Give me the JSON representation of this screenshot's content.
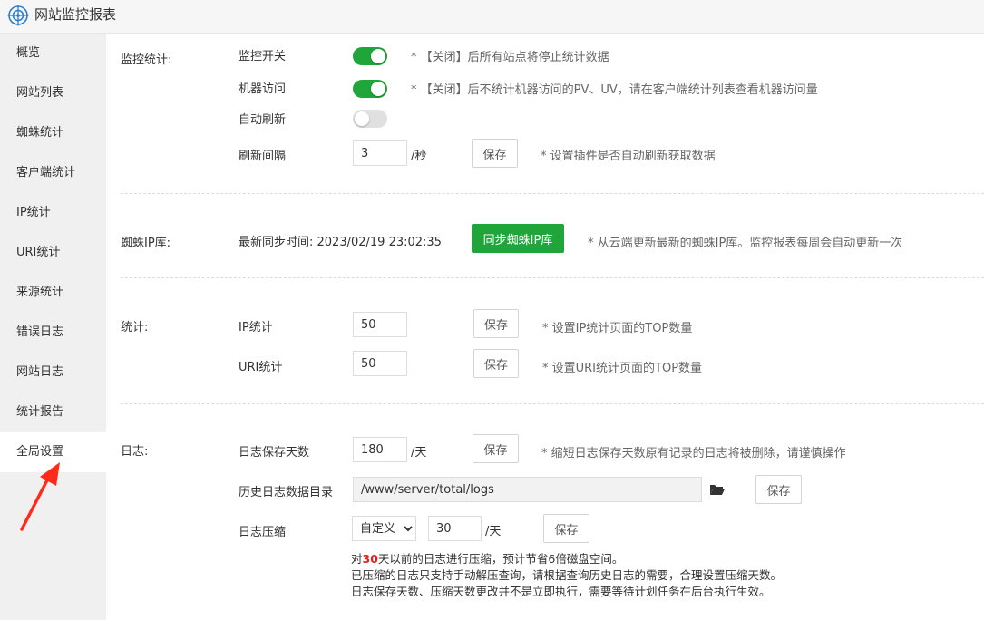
{
  "header": {
    "title": "网站监控报表",
    "icon": "globe-target-icon"
  },
  "sidebar": {
    "items": [
      {
        "label": "概览"
      },
      {
        "label": "网站列表"
      },
      {
        "label": "蜘蛛统计"
      },
      {
        "label": "客户端统计"
      },
      {
        "label": "IP统计"
      },
      {
        "label": "URI统计"
      },
      {
        "label": "来源统计"
      },
      {
        "label": "错误日志"
      },
      {
        "label": "网站日志"
      },
      {
        "label": "统计报告"
      },
      {
        "label": "全局设置",
        "active": true
      }
    ]
  },
  "monitor": {
    "section_label": "监控统计:",
    "switch_label": "监控开关",
    "switch_on": true,
    "switch_hint": "* 【关闭】后所有站点将停止统计数据",
    "bot_label": "机器访问",
    "bot_on": true,
    "bot_hint": "* 【关闭】后不统计机器访问的PV、UV，请在客户端统计列表查看机器访问量",
    "auto_refresh_label": "自动刷新",
    "auto_refresh_on": false,
    "interval_label": "刷新间隔",
    "interval_value": "3",
    "interval_unit": "/秒",
    "save_label": "保存",
    "interval_hint": "* 设置插件是否自动刷新获取数据"
  },
  "spider": {
    "section_label": "蜘蛛IP库:",
    "sync_time_text": "最新同步时间: 2023/02/19 23:02:35",
    "sync_button": "同步蜘蛛IP库",
    "hint": "* 从云端更新最新的蜘蛛IP库。监控报表每周会自动更新一次"
  },
  "stats": {
    "section_label": "统计:",
    "ip_label": "IP统计",
    "ip_value": "50",
    "ip_save": "保存",
    "ip_hint": "* 设置IP统计页面的TOP数量",
    "uri_label": "URI统计",
    "uri_value": "50",
    "uri_save": "保存",
    "uri_hint": "* 设置URI统计页面的TOP数量"
  },
  "logs": {
    "section_label": "日志:",
    "keep_days_label": "日志保存天数",
    "keep_days_value": "180",
    "keep_days_unit": "/天",
    "keep_days_save": "保存",
    "keep_days_hint": "* 缩短日志保存天数原有记录的日志将被删除，请谨慎操作",
    "dir_label": "历史日志数据目录",
    "dir_value": "/www/server/total/logs",
    "dir_save": "保存",
    "compress_label": "日志压缩",
    "compress_mode": "自定义",
    "compress_days": "30",
    "compress_unit": "/天",
    "compress_save": "保存",
    "note_prefix": "对",
    "note_days": "30",
    "note_suffix": "天以前的日志进行压缩，预计节省6倍磁盘空间。",
    "note_line2": "已压缩的日志只支持手动解压查询，请根据查询历史日志的需要，合理设置压缩天数。",
    "note_line3": "日志保存天数、压缩天数更改并不是立即执行，需要等待计划任务在后台执行生效。"
  },
  "colors": {
    "accent": "#20a53a",
    "highlight": "#e02020",
    "arrow": "#ff2a1a"
  }
}
